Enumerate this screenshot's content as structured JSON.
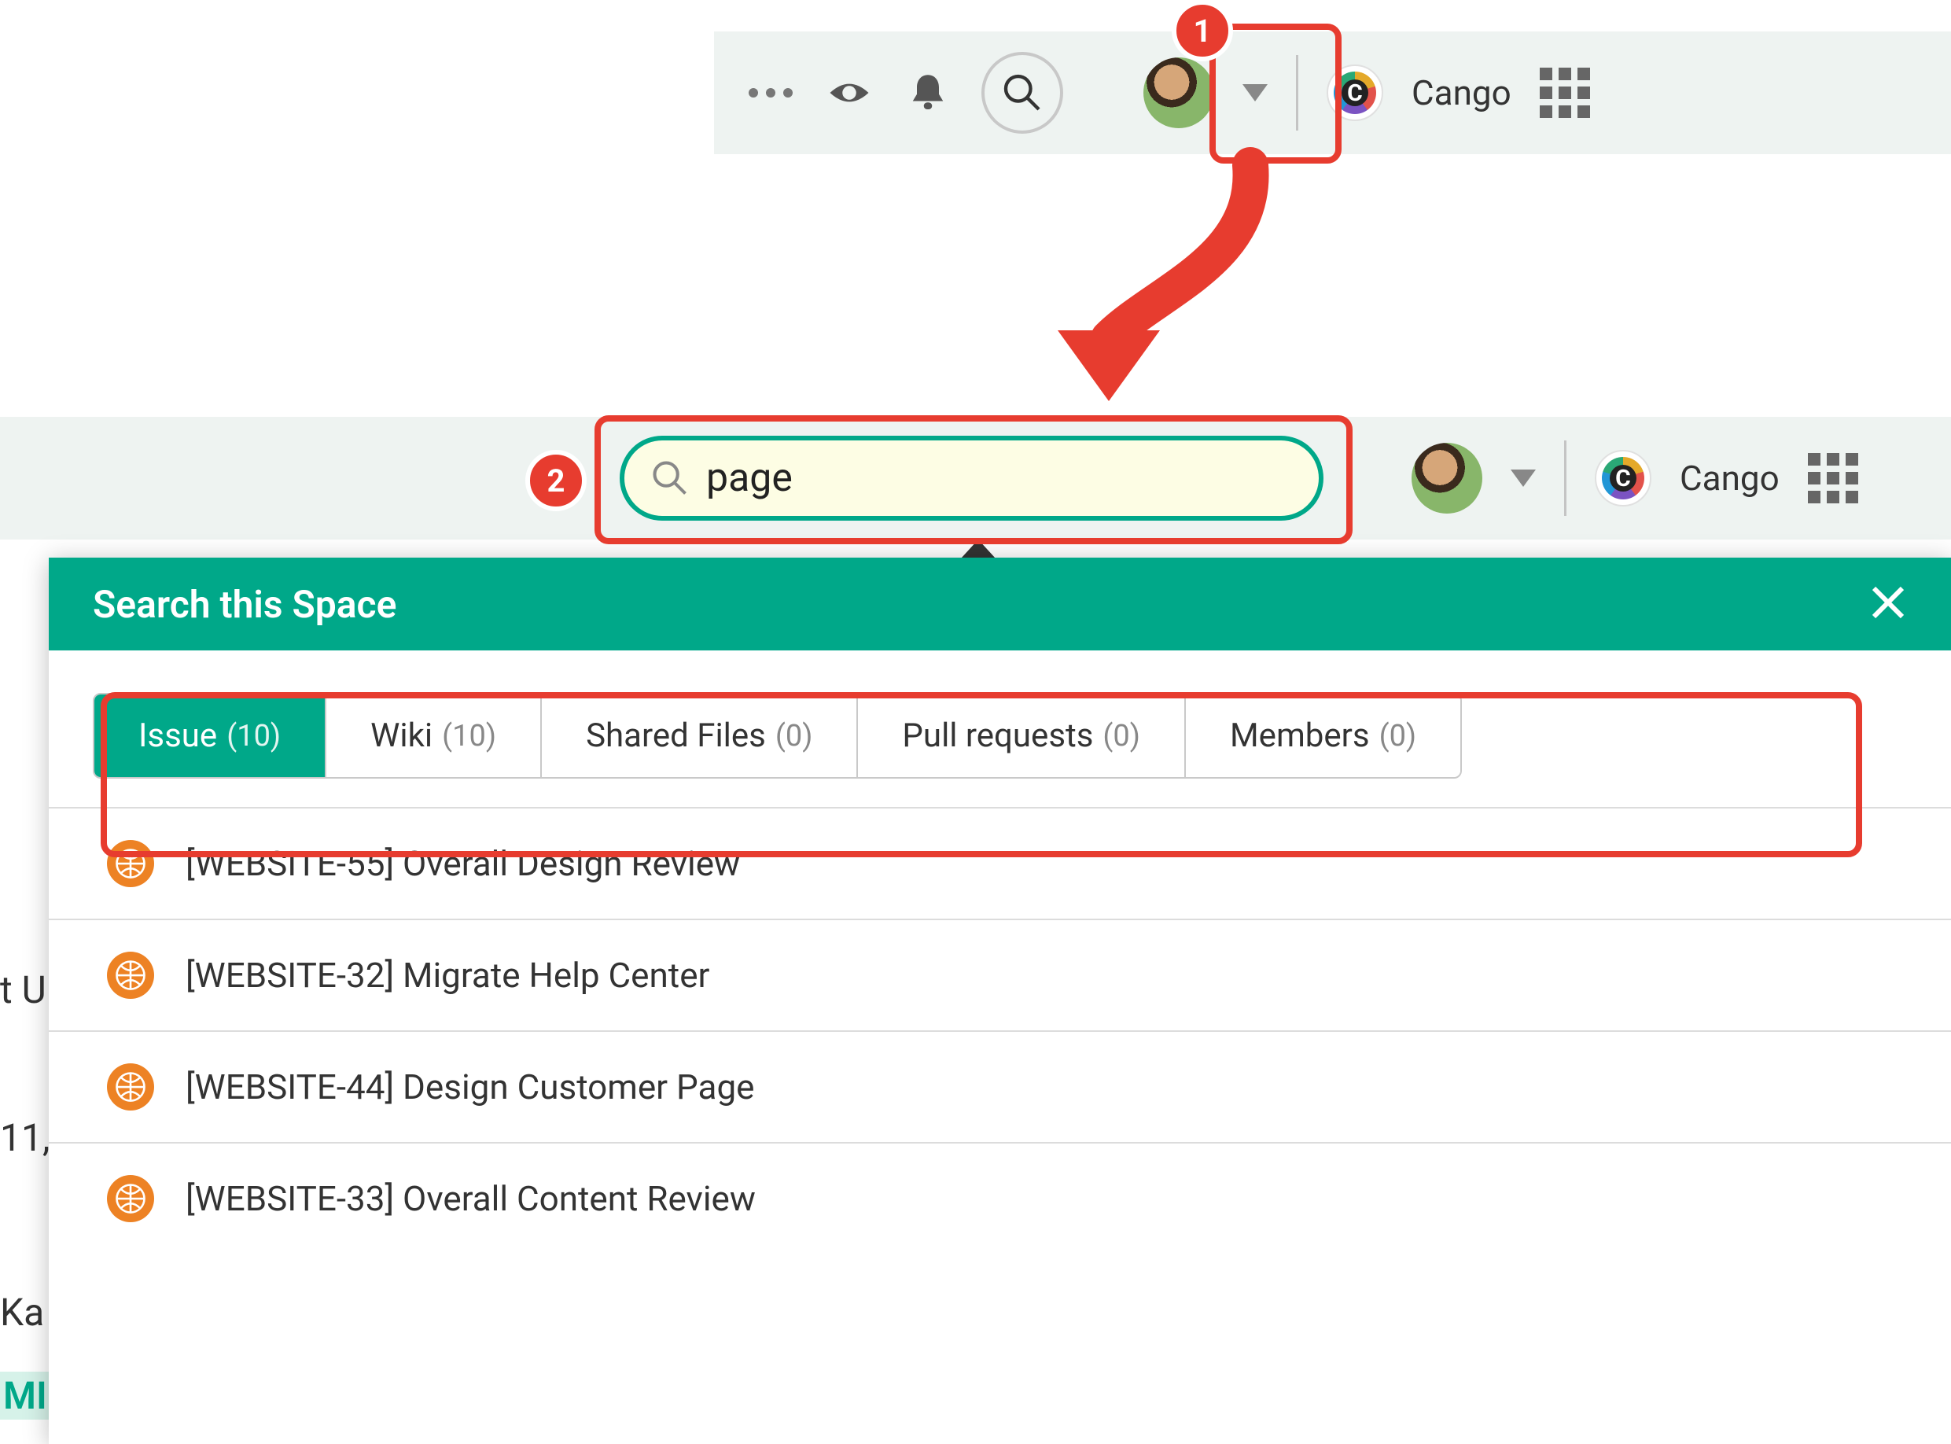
{
  "workspace_name": "Cango",
  "search_value": "page",
  "panel_title": "Search this Space",
  "tabs": [
    {
      "label": "Issue",
      "count": "(10)"
    },
    {
      "label": "Wiki",
      "count": "(10)"
    },
    {
      "label": "Shared Files",
      "count": "(0)"
    },
    {
      "label": "Pull requests",
      "count": "(0)"
    },
    {
      "label": "Members",
      "count": "(0)"
    }
  ],
  "results": [
    "[WEBSITE-55] Overall Design Review",
    "[WEBSITE-32] Migrate Help Center",
    "[WEBSITE-44] Design Customer Page",
    "[WEBSITE-33] Overall Content Review"
  ],
  "annotations": {
    "step1": "1",
    "step2": "2"
  },
  "bg_fragments": {
    "a": "t U",
    "b": "11,",
    "c": "Ka",
    "d": "MI"
  }
}
